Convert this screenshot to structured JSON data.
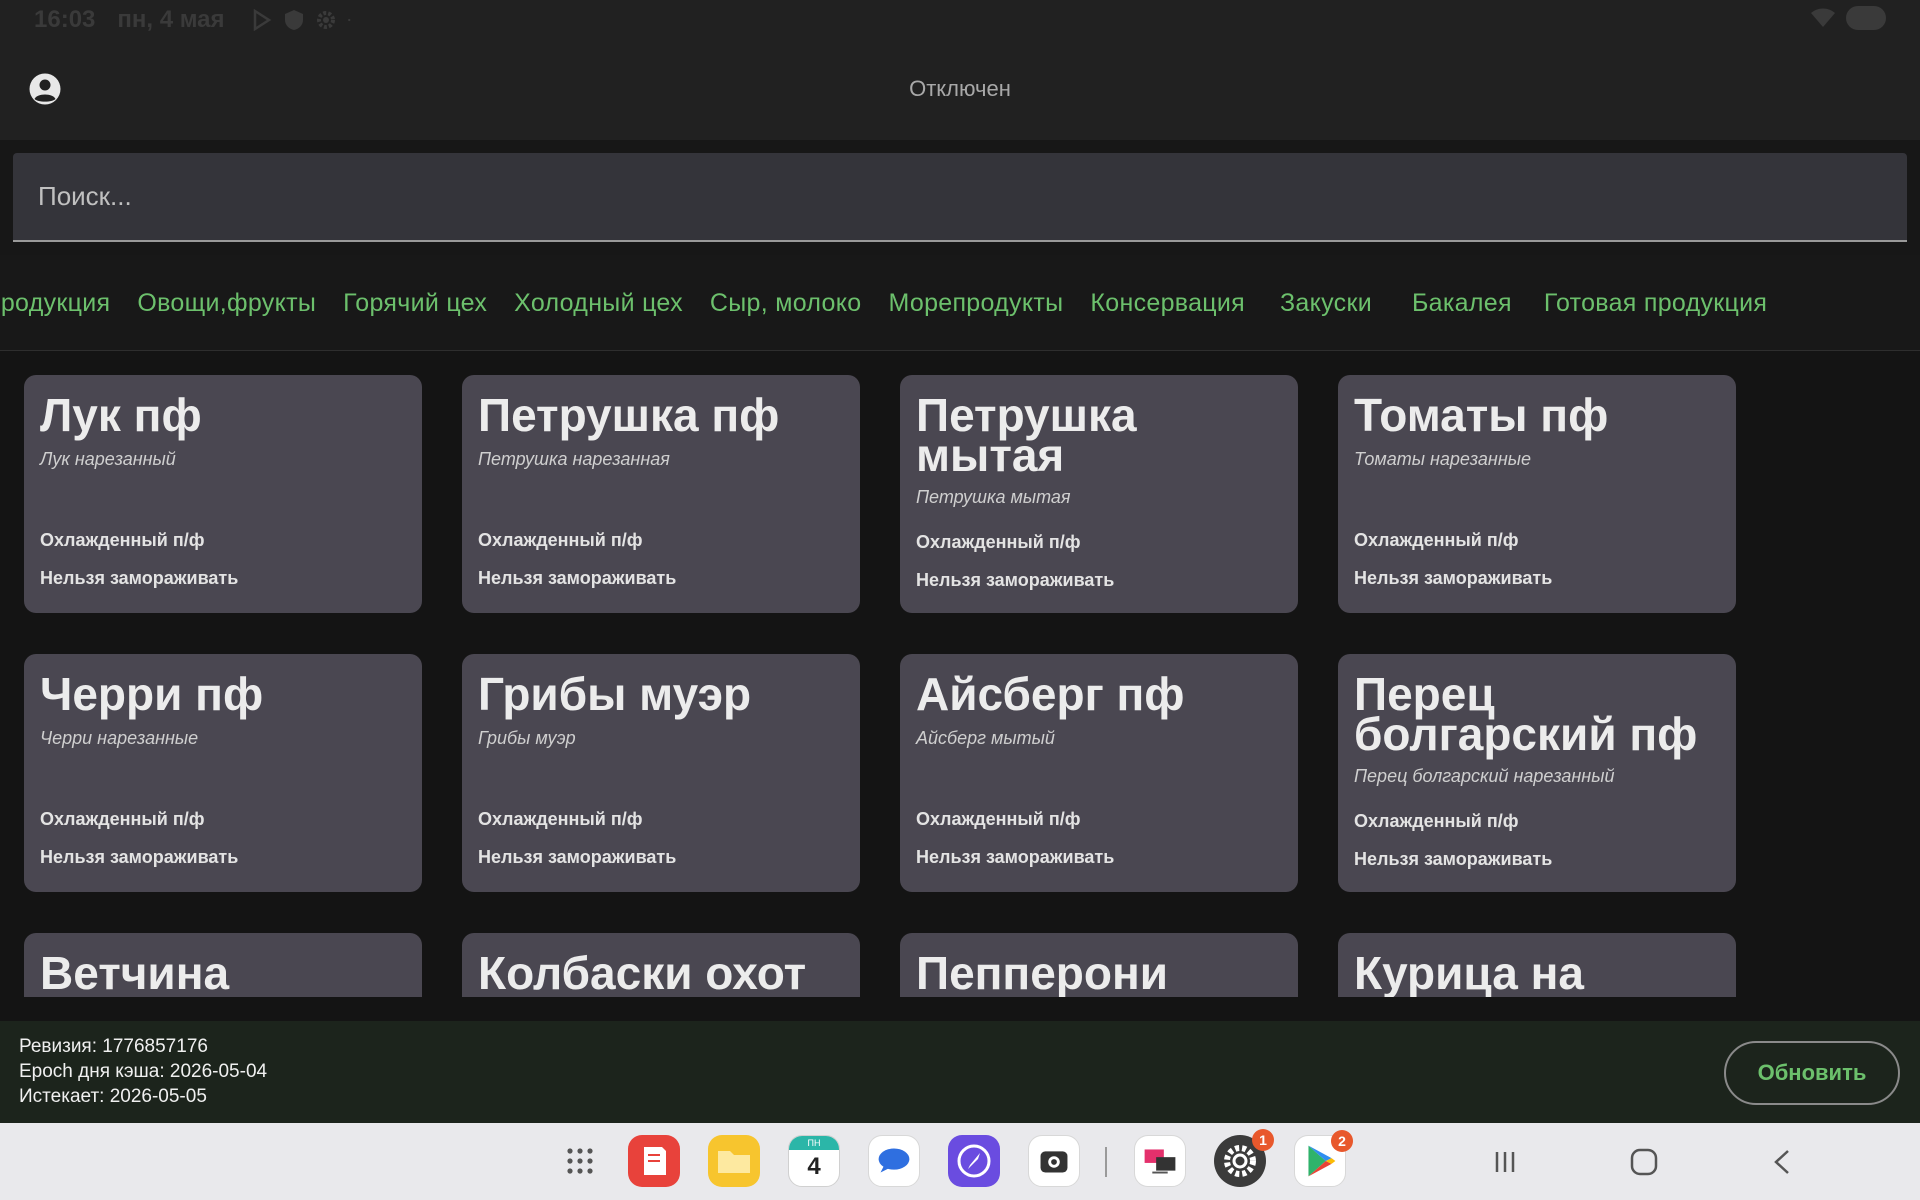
{
  "status_bar": {
    "time": "16:03",
    "date": "пн, 4 мая"
  },
  "header": {
    "connection_status": "Отключен"
  },
  "search": {
    "placeholder": "Поиск..."
  },
  "categories": [
    "продукция",
    "Овощи,фрукты",
    "Горячий цех",
    "Холодный цех",
    "Сыр, молоко",
    "Морепродукты",
    "Консервация",
    "Закуски",
    "Бакалея",
    "Готовая продукция"
  ],
  "products": [
    {
      "title": "Лук пф",
      "subtitle": "Лук нарезанный",
      "type": "Охлажденный п/ф",
      "freeze": "Нельзя замораживать"
    },
    {
      "title": "Петрушка пф",
      "subtitle": "Петрушка нарезанная",
      "type": "Охлажденный п/ф",
      "freeze": "Нельзя замораживать"
    },
    {
      "title": "Петрушка мытая",
      "subtitle": "Петрушка мытая",
      "type": "Охлажденный п/ф",
      "freeze": "Нельзя замораживать"
    },
    {
      "title": "Томаты пф",
      "subtitle": "Томаты нарезанные",
      "type": "Охлажденный п/ф",
      "freeze": "Нельзя замораживать"
    },
    {
      "title": "Черри пф",
      "subtitle": "Черри нарезанные",
      "type": "Охлажденный п/ф",
      "freeze": "Нельзя замораживать"
    },
    {
      "title": "Грибы муэр",
      "subtitle": "Грибы муэр",
      "type": "Охлажденный п/ф",
      "freeze": "Нельзя замораживать"
    },
    {
      "title": "Айсберг пф",
      "subtitle": "Айсберг мытый",
      "type": "Охлажденный п/ф",
      "freeze": "Нельзя замораживать"
    },
    {
      "title": "Перец болгарский пф",
      "subtitle": "Перец болгарский нарезанный",
      "type": "Охлажденный п/ф",
      "freeze": "Нельзя замораживать"
    },
    {
      "title": "Ветчина"
    },
    {
      "title": "Колбаски охот"
    },
    {
      "title": "Пепперони"
    },
    {
      "title": "Курица на"
    }
  ],
  "footer": {
    "revision": "Ревизия: 1776857176",
    "cache_epoch": "Epoch дня кэша: 2026-05-04",
    "expires": "Истекает: 2026-05-05",
    "refresh_label": "Обновить"
  },
  "taskbar": {
    "calendar_day_label": "ПН",
    "calendar_day_number": "4",
    "settings_badge": "1",
    "play_store_badge": "2"
  }
}
